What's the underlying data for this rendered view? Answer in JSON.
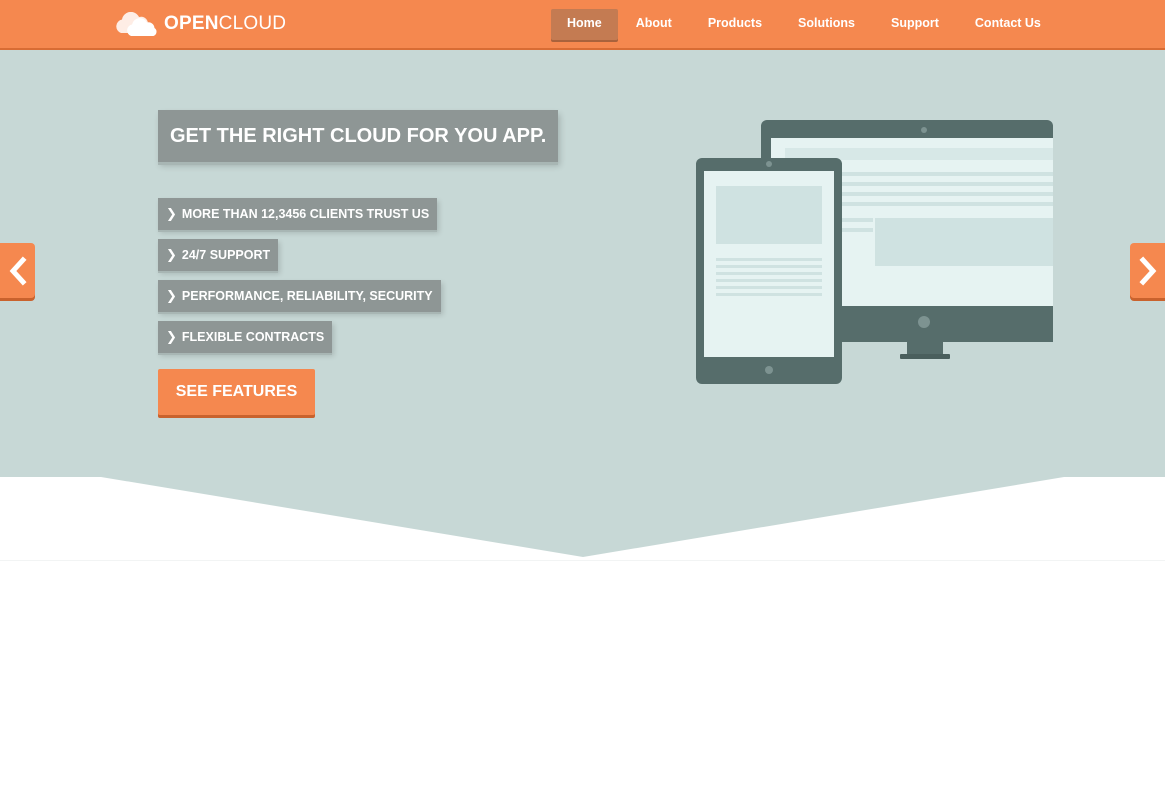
{
  "brand": {
    "name_bold": "OPEN",
    "name_light": "CLOUD",
    "logo_icon": "cloud-icon"
  },
  "nav": {
    "items": [
      {
        "label": "Home",
        "active": true
      },
      {
        "label": "About",
        "active": false
      },
      {
        "label": "Products",
        "active": false
      },
      {
        "label": "Solutions",
        "active": false
      },
      {
        "label": "Support",
        "active": false
      },
      {
        "label": "Contact Us",
        "active": false
      }
    ]
  },
  "hero": {
    "headline": "GET THE RIGHT CLOUD FOR YOU APP.",
    "features": [
      "MORE THAN 12,3456 CLIENTS TRUST US",
      "24/7 SUPPORT",
      "PERFORMANCE, RELIABILITY, SECURITY",
      "FLEXIBLE CONTRACTS"
    ],
    "feature_icon": "chevron-right-icon",
    "cta_label": "SEE FEATURES",
    "prev_icon": "chevron-left-icon",
    "next_icon": "chevron-right-icon",
    "illustration": "devices-illustration"
  },
  "colors": {
    "accent": "#f5884f",
    "hero_bg": "#c7d8d6",
    "label_bg": "#8e9695",
    "device_dark": "#566d6b",
    "screen_light": "#e6f3f2"
  }
}
